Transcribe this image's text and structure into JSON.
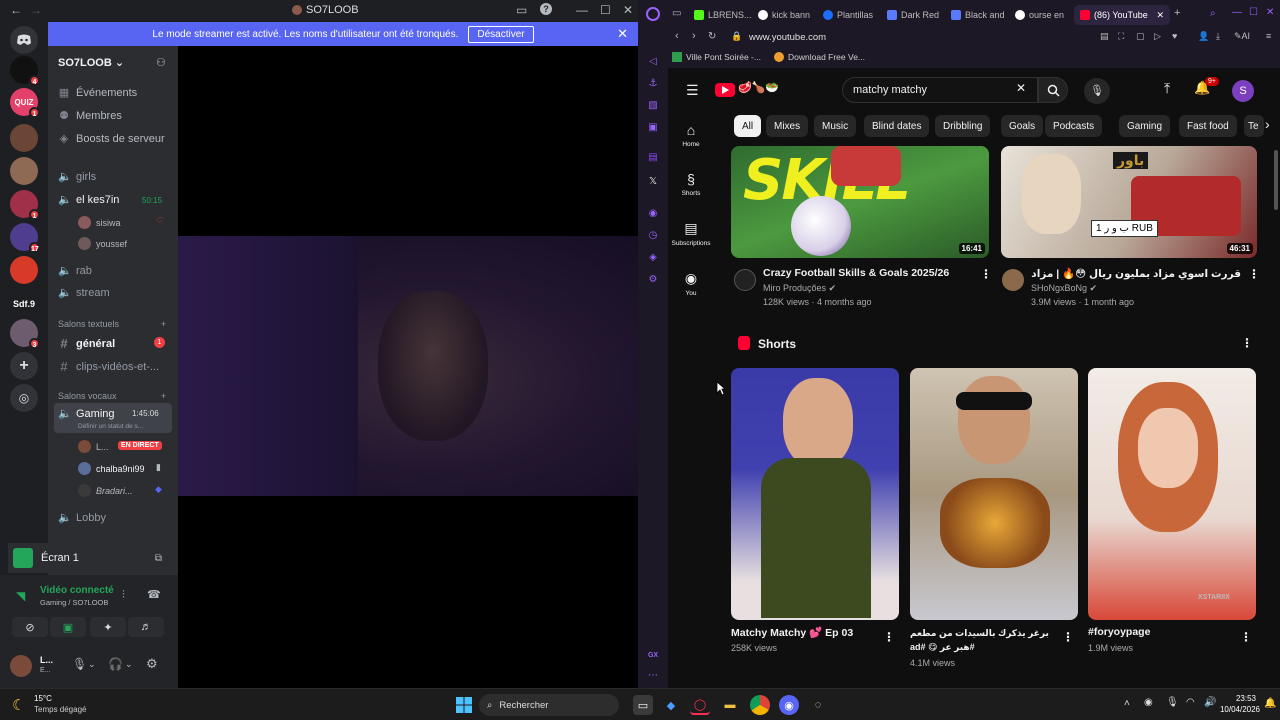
{
  "discord": {
    "window_title": "SO7LOOB",
    "banner": {
      "text": "Le mode streamer est activé. Les noms d'utilisateur ont été tronqués.",
      "button": "Désactiver"
    },
    "server_name": "SO7LOOB",
    "guild_labels": {
      "quiz": "QUIZ",
      "sdf": "Sdf.9"
    },
    "guild_badges": [
      "4",
      "1",
      "1",
      "17",
      "3"
    ],
    "menu": {
      "events": "Événements",
      "members": "Membres",
      "boosts": "Boosts de serveur"
    },
    "channels": {
      "girls": "girls",
      "elkes": "el kes7in",
      "elkes_time": "50:15",
      "user1": "sisiwa",
      "user2": "youssef",
      "rab": "rab",
      "stream": "stream",
      "cat_text": "Salons textuels",
      "general": "général",
      "general_badge": "1",
      "clips": "clips-vidéos-et-...",
      "cat_voice": "Salons vocaux",
      "gaming": "Gaming",
      "gaming_time": "1:45:06",
      "gaming_status": "Définir un statut de s...",
      "live_user": "L...",
      "live_badge": "EN DIRECT",
      "chalba": "chalba9ni99",
      "bradari": "Bradari...",
      "lobby": "Lobby"
    },
    "screen": "Écran 1",
    "voice": {
      "status": "Vidéo connecté",
      "location": "Gaming / SO7LOOB"
    },
    "user": {
      "name": "L...",
      "sub": "E..."
    }
  },
  "browser": {
    "tabs": [
      "LBRENS...",
      "kick bann",
      "Plantillas",
      "Dark Red",
      "Black and",
      "ourse en",
      "(86) YouTube"
    ],
    "address": "www.youtube.com",
    "bookmarks": [
      "Ville Pont Soirée -...",
      "Download Free Ve..."
    ],
    "toolbar_ai": "AI",
    "gx_label": "GX"
  },
  "youtube": {
    "search": "matchy matchy",
    "notif_count": "9+",
    "avatar_letter": "S",
    "chips": [
      "All",
      "Mixes",
      "Music",
      "Blind dates",
      "Dribbling",
      "Goals",
      "Podcasts",
      "Gaming",
      "Fast food",
      "Te"
    ],
    "nav": [
      "Home",
      "Shorts",
      "Subscriptions",
      "You"
    ],
    "videos": [
      {
        "title": "Crazy Football Skills & Goals 2025/26",
        "channel": "Miro Produções",
        "meta": "128K views · 4 months ago",
        "duration": "16:41",
        "thumb_text": "SKILL"
      },
      {
        "title": "قررت اسوي مزاد بمليون ريال 😳🔥 | مزاد الاعفاء (#6",
        "channel": "SHoNgxBoNg",
        "meta": "3.9M views · 1 month ago",
        "duration": "46:31",
        "thumb_text": "باور",
        "plate_text": "ب و ر 1 RUB"
      }
    ],
    "shorts_heading": "Shorts",
    "shorts": [
      {
        "title": "Matchy Matchy 💕 Ep 03",
        "views": "258K views"
      },
      {
        "title": "برغر يذكرك بالسيدات من مطعم #هبر عر 😋 #ad",
        "views": "4.1M views"
      },
      {
        "title": "#foryoypage",
        "views": "1.9M views",
        "watermark": "XSTARIIX"
      }
    ]
  },
  "taskbar": {
    "weather_temp": "15°C",
    "weather_text": "Temps dégagé",
    "search": "Rechercher",
    "time": "23:53",
    "date": "10/04/2026"
  }
}
